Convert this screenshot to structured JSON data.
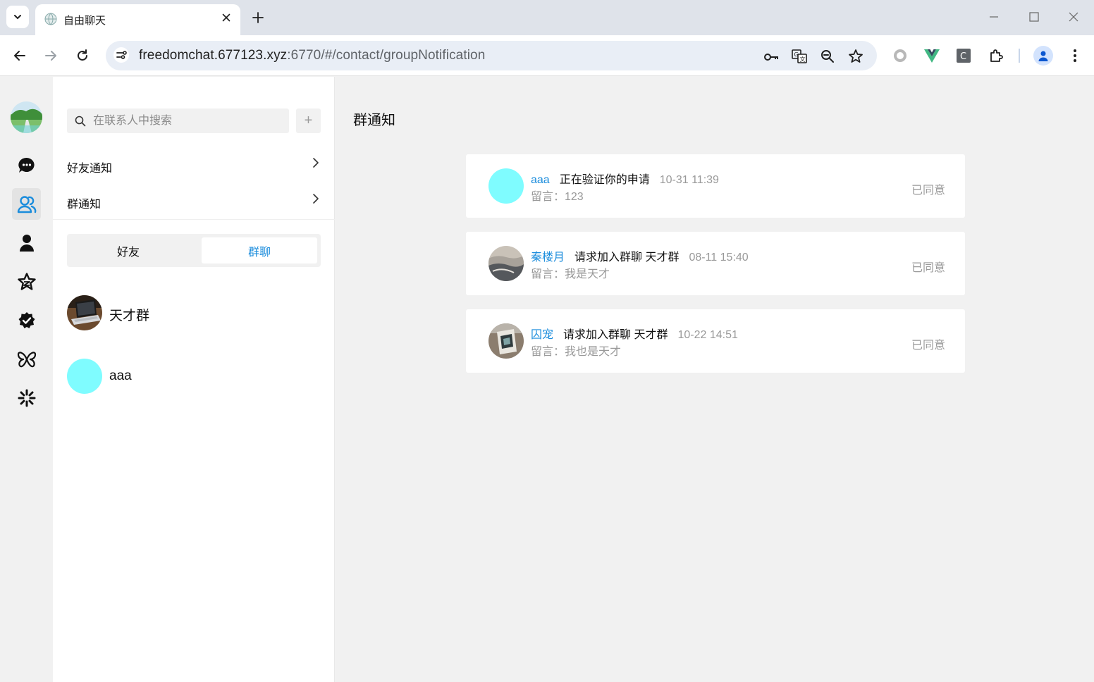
{
  "browser": {
    "tab_title": "自由聊天",
    "url_host": "freedomchat.677123.xyz",
    "url_rest": ":6770/#/contact/groupNotification"
  },
  "sidebar": {
    "items": [
      {
        "icon": "chat-icon"
      },
      {
        "icon": "contacts-icon",
        "active": true
      },
      {
        "icon": "user-icon"
      },
      {
        "icon": "star-icon"
      },
      {
        "icon": "verified-icon"
      },
      {
        "icon": "butterfly-icon"
      },
      {
        "icon": "spark-icon"
      }
    ]
  },
  "contacts": {
    "search_placeholder": "在联系人中搜索",
    "add_label": "+",
    "friend_notice": "好友通知",
    "group_notice": "群通知",
    "tabs": [
      "好友",
      "群聊"
    ],
    "active_tab": 1,
    "list": [
      {
        "name": "天才群",
        "avatar": "laptop-photo"
      },
      {
        "name": "aaa",
        "avatar_color": "#7ffcff"
      }
    ]
  },
  "main": {
    "title": "群通知",
    "notifications": [
      {
        "name": "aaa",
        "action": "正在验证你的申请",
        "time": "10-31 11:39",
        "message": "留言：123",
        "status": "已同意",
        "avatar_color": "#7ffcff"
      },
      {
        "name": "秦楼月",
        "action": "请求加入群聊 天才群",
        "time": "08-11 15:40",
        "message": "留言：我是天才",
        "status": "已同意",
        "avatar": "landscape-photo"
      },
      {
        "name": "囚宠",
        "action": "请求加入群聊 天才群",
        "time": "10-22 14:51",
        "message": "留言：我也是天才",
        "status": "已同意",
        "avatar": "device-photo"
      }
    ]
  },
  "colors": {
    "accent": "#1a8cdc",
    "muted": "#999999",
    "background": "#f1f1f1"
  }
}
